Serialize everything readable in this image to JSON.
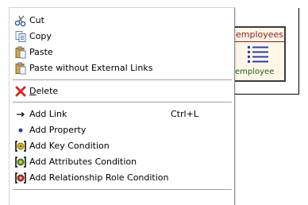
{
  "diagram": {
    "entity_title": "employees",
    "entity_name": "employee"
  },
  "menu": {
    "items": [
      {
        "label": "Cut",
        "icon": "scissors-icon"
      },
      {
        "label": "Copy",
        "icon": "copy-icon"
      },
      {
        "label": "Paste",
        "icon": "paste-icon"
      },
      {
        "label": "Paste without External Links",
        "icon": "paste-icon"
      },
      {
        "label": "Delete",
        "icon": "delete-x-icon"
      },
      {
        "label": "Add Link",
        "icon": "arrow-right-icon",
        "accelerator": "Ctrl+L"
      },
      {
        "label": "Add Property",
        "icon": "bullet-icon"
      },
      {
        "label": "Add Key Condition",
        "icon": "key-condition-icon"
      },
      {
        "label": "Add Attributes Condition",
        "icon": "attributes-condition-icon"
      },
      {
        "label": "Add Relationship Role Condition",
        "icon": "relationship-condition-icon"
      }
    ]
  },
  "colors": {
    "entity_title": "#8b1c1c",
    "entity_name": "#1f5e1f",
    "delete_red": "#d42a2a",
    "bullet_blue": "#2b3fa8"
  }
}
